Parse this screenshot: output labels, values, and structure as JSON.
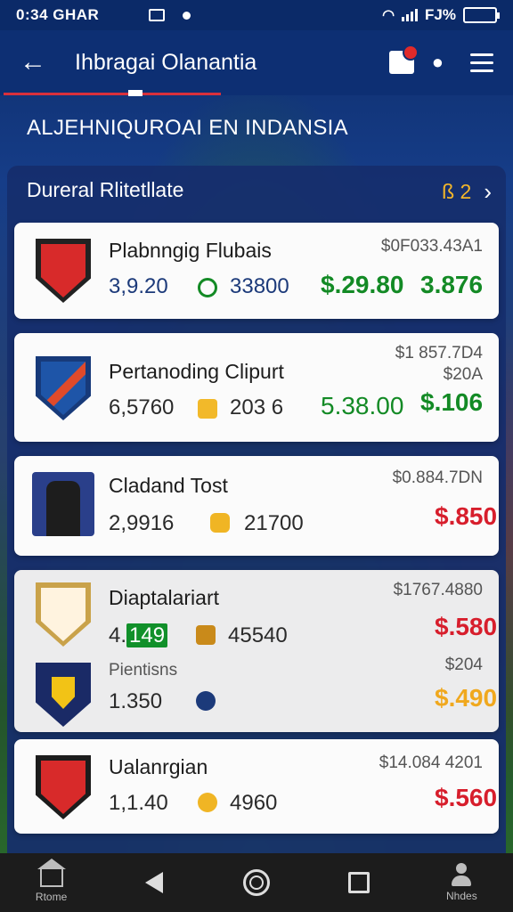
{
  "status_bar": {
    "time": "0:34 GHAR",
    "battery": "FJ%"
  },
  "app_bar": {
    "title": "Ihbragai Olanantia"
  },
  "section": {
    "title": "ALJEHNIQUROAI EN INDANSIA"
  },
  "panel": {
    "title": "Dureral Rlitetllate",
    "badge": "ß 2"
  },
  "colors": {
    "green": "#138a25",
    "red": "#d71e2c",
    "orange": "#f0a81e",
    "accent": "#0d2f73"
  },
  "cards": [
    {
      "name": "Plabnngig Flubais",
      "stat1": "3,9.20",
      "stat2": "33800",
      "small": "$0F033.43A1",
      "price1": "$.29.80",
      "price2": "3.876"
    },
    {
      "name": "Pertanoding Clipurt",
      "stat1": "6,5760",
      "stat2": "203 6",
      "small1": "$1 857.7D4",
      "small2": "$20A",
      "price1": "5.38.00",
      "price2": "$.106"
    },
    {
      "name": "Cladand Tost",
      "stat1": "2,9916",
      "stat2": "21700",
      "small": "$0.884.7DN",
      "price": "$.850"
    },
    {
      "name": "Diaptalariart",
      "stat1": "4.",
      "stat1_highlight": "149",
      "stat2": "45540",
      "small": "$1767.4880",
      "price": "$.580",
      "sub_name": "Pientisns",
      "sub_stat1": "1.350",
      "sub_small": "$204",
      "sub_price": "$.490"
    },
    {
      "name": "Ualanrgian",
      "stat1": "1,1.40",
      "stat2": "4960",
      "small": "$14.084 4201",
      "price": "$.560"
    }
  ],
  "nav": {
    "home_label": "Rtome",
    "profile_label": "Nhdes"
  }
}
